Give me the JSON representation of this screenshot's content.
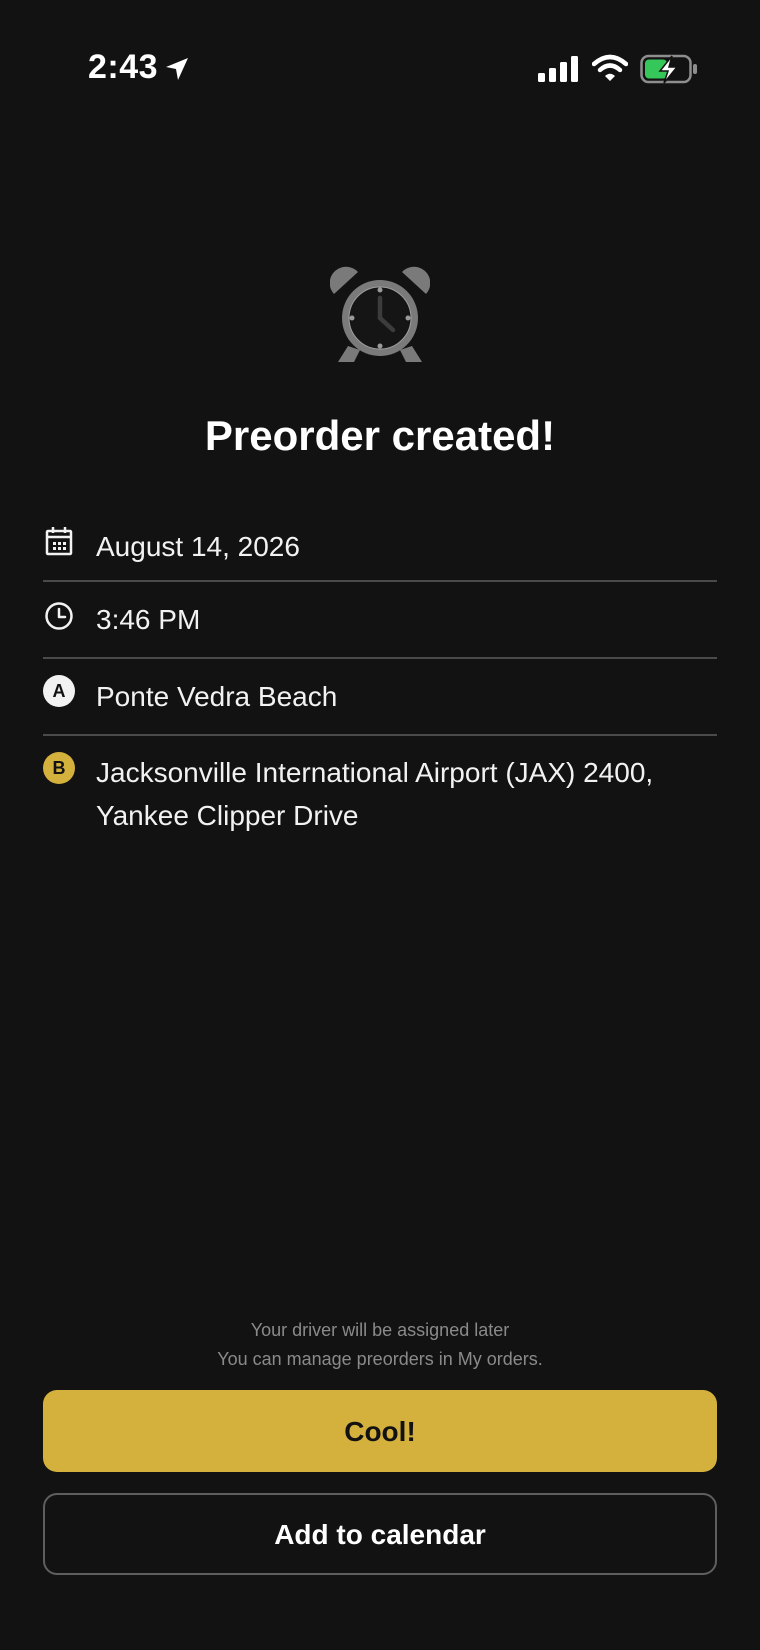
{
  "status_bar": {
    "time": "2:43",
    "icons": [
      "location-arrow-icon",
      "cellular-signal-icon",
      "wifi-icon",
      "battery-charging-icon"
    ]
  },
  "header": {
    "icon": "alarm-clock-icon",
    "title": "Preorder created!"
  },
  "details": {
    "date": "August 14, 2026",
    "time": "3:46 PM",
    "point_a": {
      "badge": "A",
      "address": "Ponte Vedra Beach"
    },
    "point_b": {
      "badge": "B",
      "address": "Jacksonville International Airport (JAX) 2400, Yankee Clipper Drive"
    }
  },
  "footer": {
    "note_line1": "Your driver will be assigned later",
    "note_line2": "You can manage preorders in My orders.",
    "primary_button": "Cool!",
    "secondary_button": "Add to calendar"
  },
  "colors": {
    "background": "#121212",
    "accent": "#d4b03c",
    "battery_green": "#35c759"
  }
}
